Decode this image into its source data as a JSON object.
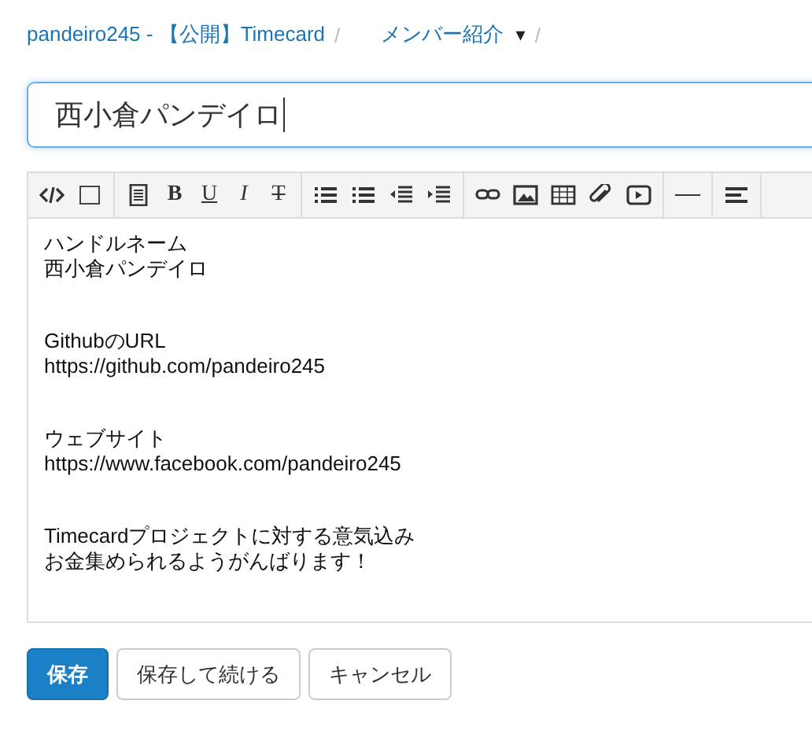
{
  "breadcrumb": {
    "project": "pandeiro245 - 【公開】Timecard",
    "separator": "/",
    "page": "メンバー紹介",
    "dropdown_caret": "▾"
  },
  "title_field": {
    "value": "西小倉パンデイロ"
  },
  "toolbar": {
    "groups": [
      [
        {
          "kind": "code"
        },
        {
          "kind": "box"
        }
      ],
      [
        {
          "kind": "paragraph"
        },
        {
          "kind": "bold",
          "label": "B"
        },
        {
          "kind": "underline",
          "label": "U"
        },
        {
          "kind": "italic",
          "label": "I"
        },
        {
          "kind": "strike",
          "label": "T"
        }
      ],
      [
        {
          "kind": "ul"
        },
        {
          "kind": "ol"
        },
        {
          "kind": "outdent"
        },
        {
          "kind": "indent"
        }
      ],
      [
        {
          "kind": "link"
        },
        {
          "kind": "image"
        },
        {
          "kind": "table"
        },
        {
          "kind": "attach"
        },
        {
          "kind": "video"
        }
      ],
      [
        {
          "kind": "hr"
        }
      ],
      [
        {
          "kind": "align"
        }
      ]
    ]
  },
  "editor": {
    "blocks": [
      [
        "ハンドルネーム",
        "西小倉パンデイロ"
      ],
      [
        "GithubのURL",
        "https://github.com/pandeiro245"
      ],
      [
        "ウェブサイト",
        "https://www.facebook.com/pandeiro245"
      ],
      [
        "Timecardプロジェクトに対する意気込み",
        "お金集められるようがんばります！"
      ]
    ]
  },
  "buttons": [
    {
      "label": "保存",
      "kind": "primary"
    },
    {
      "label": "保存して続ける",
      "kind": "default"
    },
    {
      "label": "キャンセル",
      "kind": "default"
    }
  ]
}
